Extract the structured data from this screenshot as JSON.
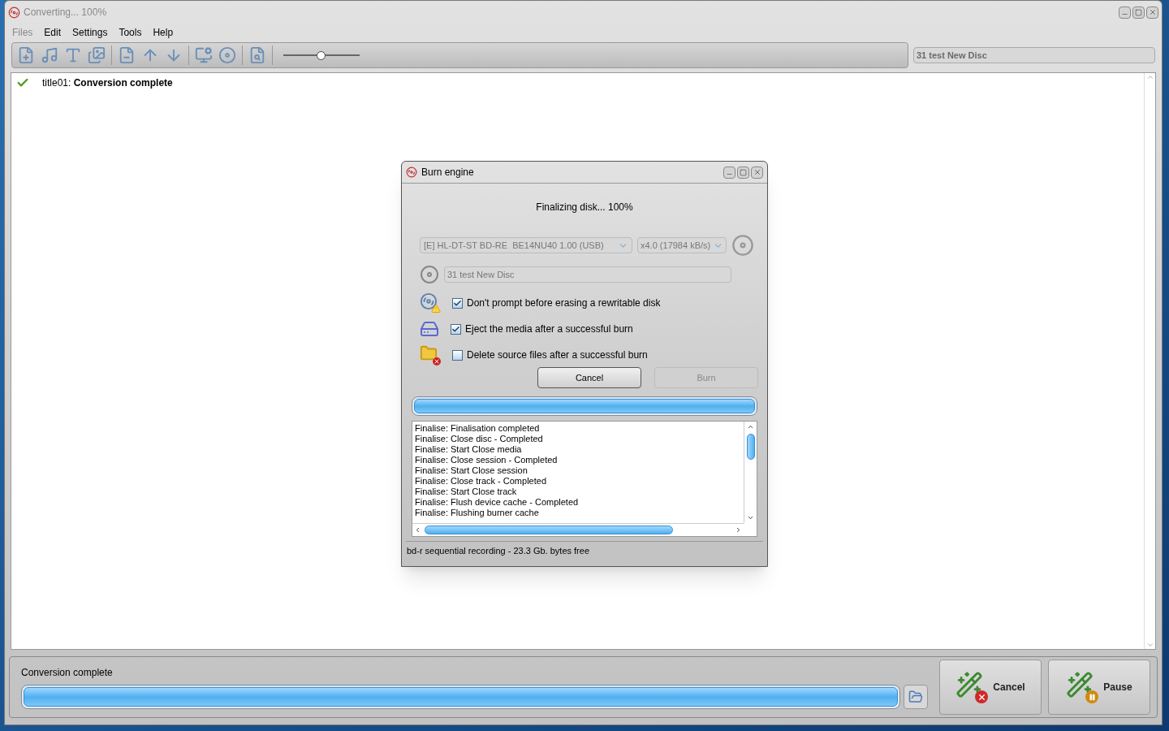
{
  "window": {
    "title": "Converting... 100%"
  },
  "menu": [
    {
      "label": "Files",
      "disabled": true
    },
    {
      "label": "Edit",
      "disabled": false
    },
    {
      "label": "Settings",
      "disabled": false
    },
    {
      "label": "Tools",
      "disabled": false
    },
    {
      "label": "Help",
      "disabled": false
    }
  ],
  "toolbar": {
    "zoom_slider": {
      "level": 0.5
    },
    "disc_label": "31 test New Disc"
  },
  "list": {
    "items": [
      {
        "done": true,
        "text": "title01: **Conversion complete**"
      }
    ]
  },
  "dialog": {
    "title": "Burn engine",
    "status": "Finalizing disk... 100%",
    "drive": "[E] HL-DT-ST BD-RE  BE14NU40 1.00 (USB)",
    "speed": "x4.0 (17984 kB/s)",
    "disc_name": "31 test New Disc",
    "options": [
      {
        "kind": "erase",
        "label": "Don't prompt before erasing a rewritable disk",
        "checked": true
      },
      {
        "kind": "eject",
        "label": "Eject the media after a successful burn",
        "checked": true
      },
      {
        "kind": "delete",
        "label": "Delete source files after a successful burn",
        "checked": false
      }
    ],
    "buttons": [
      {
        "label": "Cancel",
        "disabled": false
      },
      {
        "label": "Burn",
        "disabled": true
      }
    ],
    "progress": {
      "level": 1
    },
    "log": [
      "Finalise: Finalisation completed",
      "Finalise: Close disc - Completed",
      "Finalise: Start Close media",
      "Finalise: Close session - Completed",
      "Finalise: Start Close session",
      "Finalise: Close track - Completed",
      "Finalise: Start Close track",
      "Finalise: Flush device cache - Completed",
      "Finalise: Flushing burner cache"
    ],
    "status_bar": "bd-r sequential recording - 23.3 Gb. bytes free"
  },
  "footer": {
    "status": "Conversion complete",
    "progress": {
      "level": 1
    },
    "buttons": [
      {
        "kind": "cancel",
        "label": "Cancel"
      },
      {
        "kind": "pause",
        "label": "Pause"
      }
    ]
  }
}
